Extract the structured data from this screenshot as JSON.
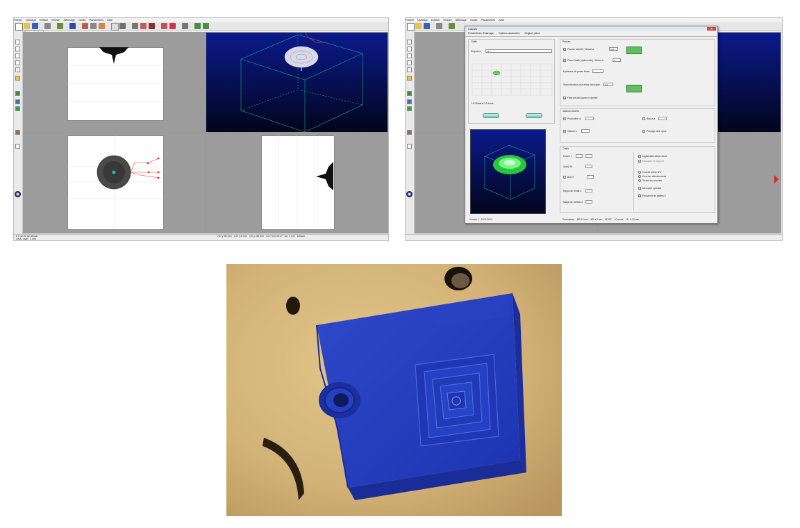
{
  "left_screenshot": {
    "menu": [
      "Fichier",
      "Usinage",
      "Edition",
      "Dessin",
      "Affichage",
      "Outils",
      "Paramètres",
      "Aide"
    ],
    "tab_label": "Prévisualisation",
    "status_left_1": "0 h 12 22 de dessin",
    "status_left_2": "CNA : outil : 1 mm",
    "status_right": [
      "x:37  y:36 mm",
      "x:22  y:6 mm",
      "x:0  y:-38 mm",
      "0:17 mm 33:27",
      "Av: 1 mm",
      "Dessin"
    ]
  },
  "right_screenshot": {
    "menu": [
      "Fichier",
      "Usinage",
      "Edition",
      "Dessin",
      "Affichage",
      "Outils",
      "Paramètres",
      "Aide"
    ],
    "dialog_title": "Calculs",
    "tabs": [
      "Paramètres d'usinage",
      "Options avancées",
      "Origine pièce"
    ],
    "group_outils": "Outils",
    "sequence_label": "Séquence",
    "sequence_value": "14",
    "group_passes": "Passes",
    "pass_rough_label": "Passes usinées, vitesse à",
    "pass_rough_value": "100",
    "pass_finish_label": "Passe finale (optionnelle), vitesse à",
    "pass_finish_value": "0",
    "thickness_label": "Epaisseur de passe finale",
    "oversize_label": "Surprofondeur pour fraise découpée",
    "oversize_value": "0.2",
    "cut_last_label": "Faire les découpes en dernier",
    "group_holes": "Valeurs forcées",
    "hole1_label": "Profondeur à",
    "hole2_label": "Vitesse à",
    "hole3_label": "Rayon à",
    "hole4_label": "Perçage sans cycle",
    "group_tools": "Outils",
    "tool_label1": "Entrée Y",
    "tool_label2": "X(de) 39",
    "tool_label3": "Brut X",
    "tool_label4": "Rayon de retrait Z",
    "tool_label5": "Marge de contact Z",
    "opt1": "Digital alternatives seule",
    "opt2": "Découper en support",
    "opt3": "Couche active N°1",
    "opt4": "Couches sélectionnées",
    "opt5": "Toutes les couches",
    "opt6": "Découper spéciale",
    "opt7": "Enchaîner les paliers Z",
    "tool_info": "1.0  Global  ø 3   2 dents",
    "version": "Version 1 - 18/11/2014",
    "footer_tabs": [
      "Paramètres",
      "MR 10 mm",
      "ØS ø 3 mm",
      "HF/SC",
      "10 mm/s",
      "15 - 0.25 mm"
    ]
  },
  "photo": {
    "description_none": ""
  }
}
